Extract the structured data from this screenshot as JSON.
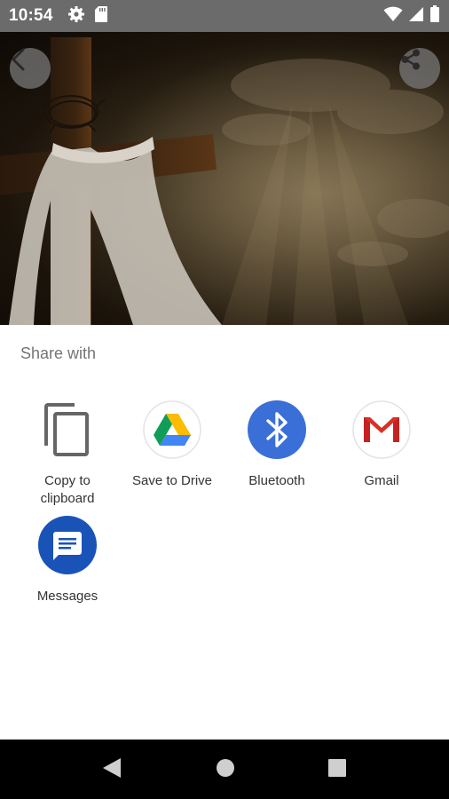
{
  "status_bar": {
    "time": "10:54",
    "icons": [
      "gear-icon",
      "sd-card-icon",
      "wifi-icon",
      "signal-icon",
      "battery-icon"
    ]
  },
  "header": {
    "back_icon": "chevron-left-icon",
    "share_icon": "share-icon"
  },
  "share_sheet": {
    "title": "Share with",
    "targets": [
      {
        "label": "Copy to clipboard",
        "icon": "copy-icon"
      },
      {
        "label": "Save to Drive",
        "icon": "google-drive-icon"
      },
      {
        "label": "Bluetooth",
        "icon": "bluetooth-icon"
      },
      {
        "label": "Gmail",
        "icon": "gmail-icon"
      },
      {
        "label": "Messages",
        "icon": "messages-icon"
      }
    ]
  },
  "nav_bar": {
    "buttons": [
      "back-triangle-icon",
      "home-circle-icon",
      "recents-square-icon"
    ]
  },
  "colors": {
    "status_bar": "#6b6b6b",
    "bluetooth_blue": "#3a6fd8",
    "messages_blue": "#1a53b8",
    "gmail_red": "#d93025"
  }
}
